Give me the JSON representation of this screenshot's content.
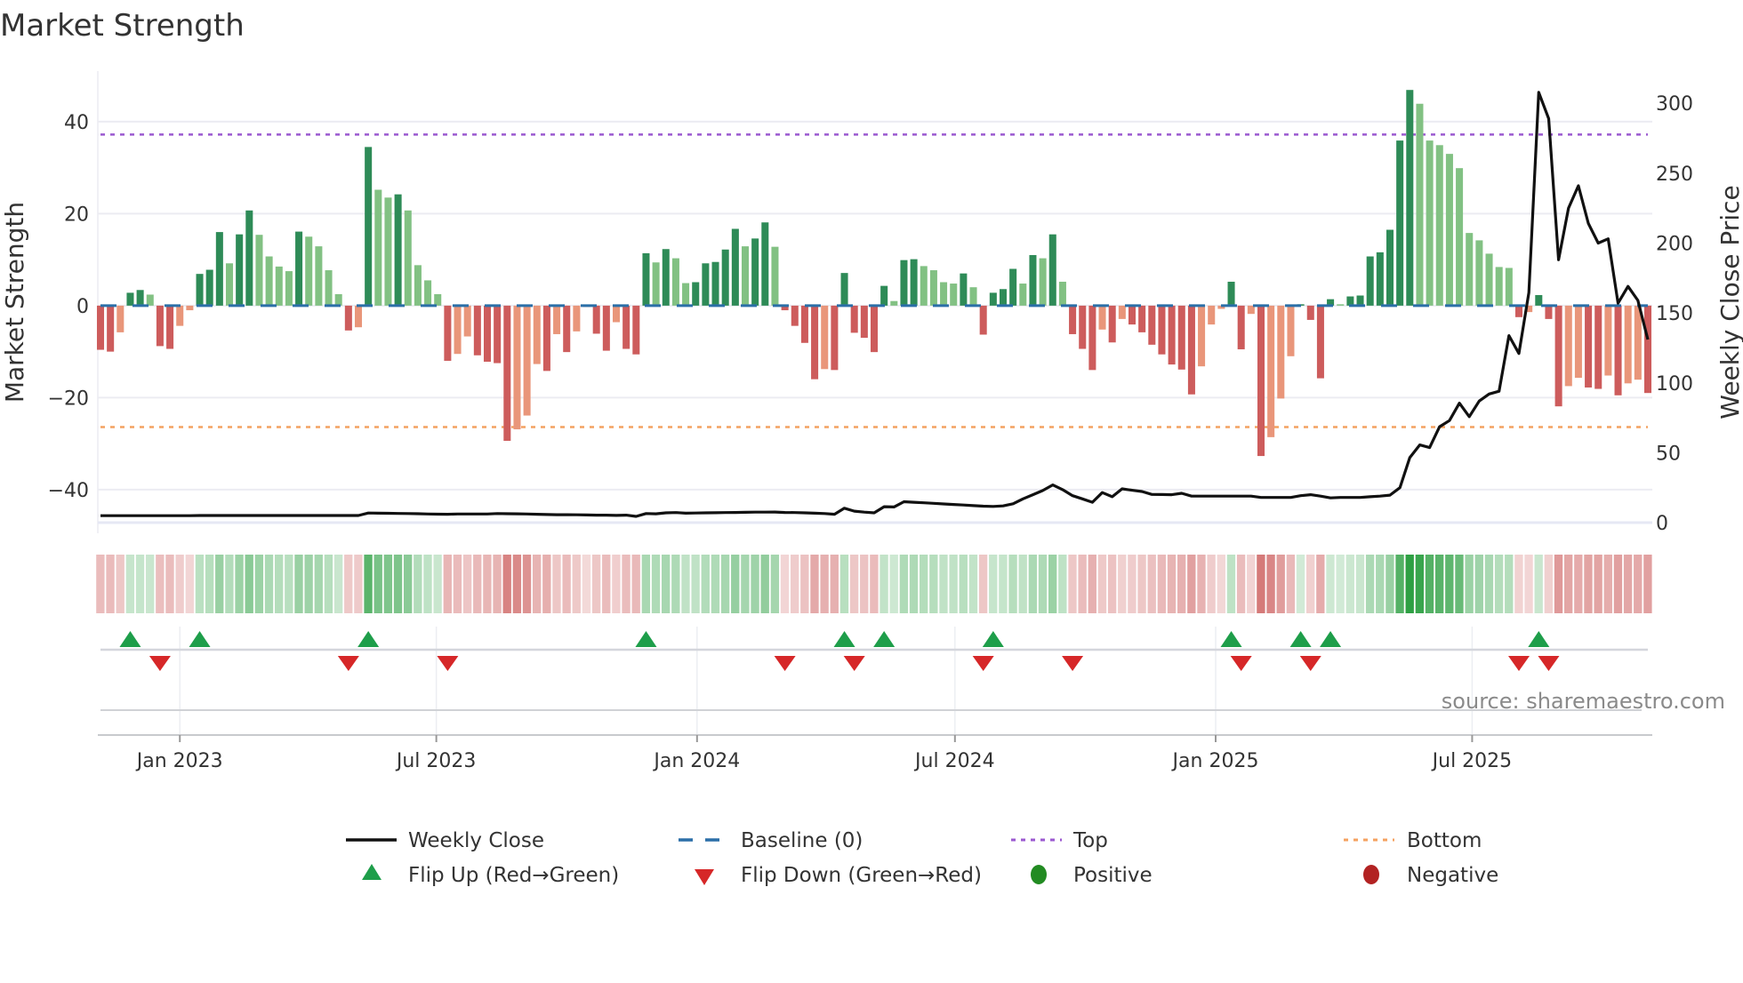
{
  "title": "Market Strength",
  "source": "source: sharemaestro.com",
  "colors": {
    "strong_positive": "#2e8b57",
    "weak_positive": "#82c183",
    "strong_negative": "#cd5c5c",
    "weak_negative": "#e9967a",
    "weekly_close": "#111111",
    "baseline": "#2b6fa8",
    "top": "#9b59d0",
    "bottom": "#f4a261",
    "flip_up": "#1e9e4a",
    "flip_down": "#d62728",
    "positive": "#228b22",
    "negative": "#b22222",
    "heat_green": "#2ea043",
    "heat_red": "#c8504f"
  },
  "legend": {
    "weekly_close": "Weekly Close",
    "baseline": "Baseline (0)",
    "top": "Top",
    "bottom": "Bottom",
    "flip_up": "Flip Up (Red→Green)",
    "flip_down": "Flip Down (Green→Red)",
    "positive": "Positive",
    "negative": "Negative"
  },
  "chart_data": {
    "type": "bar",
    "title": "Market Strength",
    "ylabel": "Market Strength",
    "y2label": "Weekly Close Price",
    "ylim": [
      -49.5,
      51
    ],
    "y2lim": [
      -7.6,
      323
    ],
    "yticks": [
      40,
      20,
      0,
      -20,
      -40
    ],
    "y2ticks": [
      0,
      50,
      100,
      150,
      200,
      250,
      300
    ],
    "grid": true,
    "legend_placement": "bottom",
    "xticks": [
      {
        "date": "2023-01-01",
        "label": "Jan 2023"
      },
      {
        "date": "2023-07-01",
        "label": "Jul 2023"
      },
      {
        "date": "2024-01-01",
        "label": "Jan 2024"
      },
      {
        "date": "2024-07-01",
        "label": "Jul 2024"
      },
      {
        "date": "2025-01-01",
        "label": "Jan 2025"
      },
      {
        "date": "2025-07-01",
        "label": "Jul 2025"
      }
    ],
    "top_level": 37.2,
    "bottom_level": -26.4,
    "baseline": 0,
    "dates": [
      "2022-11-06",
      "2022-11-13",
      "2022-11-20",
      "2022-11-27",
      "2022-12-04",
      "2022-12-11",
      "2022-12-18",
      "2022-12-25",
      "2023-01-01",
      "2023-01-08",
      "2023-01-15",
      "2023-01-22",
      "2023-01-29",
      "2023-02-05",
      "2023-02-12",
      "2023-02-19",
      "2023-02-26",
      "2023-03-05",
      "2023-03-12",
      "2023-03-19",
      "2023-03-26",
      "2023-04-02",
      "2023-04-09",
      "2023-04-16",
      "2023-04-23",
      "2023-04-30",
      "2023-05-07",
      "2023-05-14",
      "2023-05-21",
      "2023-05-28",
      "2023-06-04",
      "2023-06-11",
      "2023-06-18",
      "2023-06-25",
      "2023-07-02",
      "2023-07-09",
      "2023-07-16",
      "2023-07-23",
      "2023-07-30",
      "2023-08-06",
      "2023-08-13",
      "2023-08-20",
      "2023-08-27",
      "2023-09-03",
      "2023-09-10",
      "2023-09-17",
      "2023-09-24",
      "2023-10-01",
      "2023-10-08",
      "2023-10-15",
      "2023-10-22",
      "2023-10-29",
      "2023-11-05",
      "2023-11-12",
      "2023-11-19",
      "2023-11-26",
      "2023-12-03",
      "2023-12-10",
      "2023-12-17",
      "2023-12-24",
      "2023-12-31",
      "2024-01-07",
      "2024-01-14",
      "2024-01-21",
      "2024-01-28",
      "2024-02-04",
      "2024-02-11",
      "2024-02-18",
      "2024-02-25",
      "2024-03-03",
      "2024-03-10",
      "2024-03-17",
      "2024-03-24",
      "2024-03-31",
      "2024-04-07",
      "2024-04-14",
      "2024-04-21",
      "2024-04-28",
      "2024-05-05",
      "2024-05-12",
      "2024-05-19",
      "2024-05-26",
      "2024-06-02",
      "2024-06-09",
      "2024-06-16",
      "2024-06-23",
      "2024-06-30",
      "2024-07-07",
      "2024-07-14",
      "2024-07-21",
      "2024-07-28",
      "2024-08-04",
      "2024-08-11",
      "2024-08-18",
      "2024-08-25",
      "2024-09-01",
      "2024-09-08",
      "2024-09-15",
      "2024-09-22",
      "2024-09-29",
      "2024-10-06",
      "2024-10-13",
      "2024-10-20",
      "2024-10-27",
      "2024-11-03",
      "2024-11-10",
      "2024-11-17",
      "2024-11-24",
      "2024-12-01",
      "2024-12-08",
      "2024-12-15",
      "2024-12-22",
      "2024-12-29",
      "2025-01-05",
      "2025-01-12",
      "2025-01-19",
      "2025-01-26",
      "2025-02-02",
      "2025-02-09",
      "2025-02-16",
      "2025-02-23",
      "2025-03-02",
      "2025-03-09",
      "2025-03-16",
      "2025-03-23",
      "2025-03-30",
      "2025-04-06",
      "2025-04-13",
      "2025-04-20",
      "2025-04-27",
      "2025-05-04",
      "2025-05-11",
      "2025-05-18",
      "2025-05-25",
      "2025-06-01",
      "2025-06-08",
      "2025-06-15",
      "2025-06-22",
      "2025-06-29",
      "2025-07-06",
      "2025-07-13",
      "2025-07-20",
      "2025-07-27",
      "2025-08-03",
      "2025-08-10",
      "2025-08-17",
      "2025-08-24",
      "2025-08-31",
      "2025-09-07",
      "2025-09-14",
      "2025-09-21",
      "2025-09-28",
      "2025-10-05",
      "2025-10-12",
      "2025-10-19",
      "2025-10-26",
      "2025-11-02"
    ],
    "series": [
      {
        "name": "Market Strength",
        "axis": "left",
        "type": "bar",
        "values": [
          -9.6,
          -10,
          -5.8,
          2.8,
          3.4,
          2.4,
          -8.8,
          -9.4,
          -4.4,
          -1,
          6.9,
          7.8,
          16,
          9.2,
          15.5,
          20.7,
          15.4,
          10.7,
          8.5,
          7.5,
          16.1,
          15,
          12.9,
          7.7,
          2.5,
          -5.4,
          -4.7,
          34.5,
          25.2,
          23.5,
          24.2,
          20.7,
          8.8,
          5.5,
          2.5,
          -12,
          -10.5,
          -6.7,
          -10.8,
          -12.2,
          -12.5,
          -29.4,
          -26.9,
          -23.9,
          -12.7,
          -14.2,
          -6.2,
          -10.1,
          -5.6,
          -0.3,
          -6.1,
          -9.8,
          -3.6,
          -9.4,
          -10.6,
          11.4,
          9.4,
          12.3,
          10.3,
          4.9,
          5.1,
          9.2,
          9.5,
          12.2,
          16.7,
          12.9,
          14.6,
          18.1,
          12.8,
          -1,
          -4.4,
          -8.1,
          -16,
          -13.8,
          -14,
          7.1,
          -5.9,
          -7,
          -10.1,
          4.3,
          1,
          9.9,
          10.1,
          8.6,
          7.7,
          5.1,
          4.8,
          7,
          4,
          -6.3,
          2.8,
          3.6,
          8,
          4.8,
          11,
          10.3,
          15.5,
          5.2,
          -6.2,
          -9.4,
          -14,
          -5.2,
          -8,
          -2.9,
          -4.1,
          -5.8,
          -8.5,
          -10.6,
          -12.8,
          -13.9,
          -19.3,
          -13.2,
          -4.1,
          -0.7,
          5.2,
          -9.5,
          -1.8,
          -32.7,
          -28.6,
          -20.2,
          -11,
          0.3,
          -3.1,
          -15.8,
          1.4,
          0.3,
          2,
          2.2,
          10.7,
          11.6,
          16.5,
          35.9,
          46.9,
          43.9,
          35.9,
          34.9,
          33,
          29.9,
          15.8,
          14.2,
          11.3,
          8.4,
          8.2,
          -2.5,
          -1.4,
          2.3,
          -2.9,
          -21.9,
          -17.5,
          -15.7,
          -17.8,
          -18.1,
          -15.2,
          -19.5,
          -16.9,
          -16.1,
          -19
        ]
      },
      {
        "name": "Weekly Close",
        "axis": "right",
        "type": "line",
        "values": [
          5,
          5,
          5,
          5,
          5,
          5,
          5,
          5,
          5,
          5,
          5.1,
          5.1,
          5.1,
          5.1,
          5.1,
          5.1,
          5.1,
          5.1,
          5.1,
          5.1,
          5.1,
          5.1,
          5.1,
          5.1,
          5.1,
          5.1,
          5.1,
          6.9,
          6.8,
          6.7,
          6.6,
          6.5,
          6.4,
          6.2,
          6.1,
          6,
          6.2,
          6.2,
          6.2,
          6.2,
          6.5,
          6.4,
          6.3,
          6.2,
          6,
          5.8,
          5.7,
          5.7,
          5.6,
          5.5,
          5.4,
          5.4,
          5.2,
          5.4,
          4.5,
          6.5,
          6.3,
          7,
          7.2,
          6.8,
          6.9,
          7,
          7.1,
          7.2,
          7.3,
          7.4,
          7.5,
          7.5,
          7.6,
          7.3,
          7.2,
          7,
          6.8,
          6.5,
          6,
          10.3,
          8.2,
          7.5,
          7,
          11.4,
          11.2,
          15,
          14.6,
          14.2,
          13.8,
          13.4,
          13,
          12.6,
          12.2,
          11.8,
          11.6,
          12,
          13.5,
          17,
          20,
          23,
          27,
          23.6,
          19.3,
          17,
          14.6,
          21.5,
          18.5,
          24.2,
          23.2,
          22.3,
          20.2,
          20.1,
          20,
          21,
          19,
          19,
          19,
          19,
          19,
          19,
          19,
          18,
          18,
          18,
          18,
          19.3,
          20,
          19,
          17.7,
          18,
          18,
          18,
          18.5,
          19,
          19.7,
          25,
          46.5,
          55.6,
          53.7,
          68.6,
          73,
          85.5,
          75.8,
          87,
          92,
          94,
          133.8,
          121,
          164.5,
          307.8,
          289,
          188,
          225,
          241,
          214,
          200,
          203,
          157,
          169,
          159,
          131
        ]
      }
    ],
    "flip_up_dates": [
      "2022-11-27",
      "2023-01-15",
      "2023-05-14",
      "2023-11-26",
      "2024-04-14",
      "2024-05-12",
      "2024-07-28",
      "2025-01-12",
      "2025-03-02",
      "2025-03-23",
      "2025-08-17"
    ],
    "flip_down_dates": [
      "2022-12-18",
      "2023-04-30",
      "2023-07-09",
      "2024-03-03",
      "2024-04-21",
      "2024-07-21",
      "2024-09-22",
      "2025-01-19",
      "2025-03-09",
      "2025-08-03",
      "2025-08-24"
    ]
  }
}
